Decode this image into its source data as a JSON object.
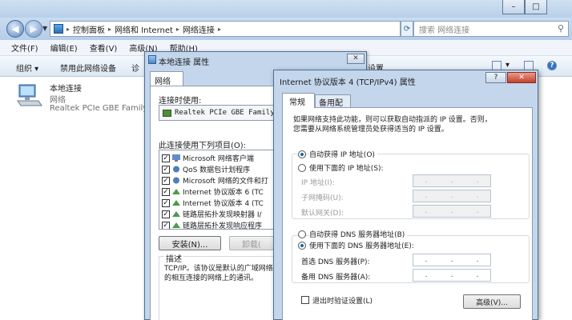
{
  "explorer": {
    "window_controls": [
      "–",
      "□"
    ],
    "address": {
      "crumbs": [
        "控制面板",
        "网络和 Internet",
        "网络连接"
      ],
      "dropdown_glyph": "▾"
    },
    "search_placeholder": "搜索 网络连接",
    "menu": [
      "文件(F)",
      "编辑(E)",
      "查看(V)",
      "高级(N)",
      "帮助(H)"
    ],
    "toolbar": {
      "organize": "组织 ▾",
      "disable": "禁用此网络设备",
      "diagnose_partial": "诊",
      "settings_partial": "设置",
      "view_dropdown": "▾"
    },
    "connection": {
      "name": "本地连接",
      "network": "网络",
      "adapter": "Realtek PCIe GBE Family"
    }
  },
  "dialog_props": {
    "title": "本地连接 属性",
    "close": "✕",
    "tab": "网络",
    "connect_using_label": "连接时使用:",
    "adapter": "Realtek PCIe GBE Family Co",
    "items_label": "此连接使用下列项目(O):",
    "items": [
      {
        "label": "Microsoft 网络客户端"
      },
      {
        "label": "QoS 数据包计划程序"
      },
      {
        "label": "Microsoft 网络的文件和打"
      },
      {
        "label": "Internet 协议版本 6 (TC"
      },
      {
        "label": "Internet 协议版本 4 (TC"
      },
      {
        "label": "链路层拓扑发现映射器 I/"
      },
      {
        "label": "链路层拓扑发现响应程序"
      }
    ],
    "install_button": "安装(N)...",
    "uninstall_button": "卸载(",
    "desc_label": "描述",
    "desc_lines": [
      "TCP/IP。该协议是默认的广域网络",
      "的相互连接的网络上的通讯。"
    ]
  },
  "dialog_ipv4": {
    "title": "Internet 协议版本 4 (TCP/IPv4) 属性",
    "help": "?",
    "close": "✕",
    "tabs": [
      "常规",
      "备用配置"
    ],
    "intro": [
      "如果网络支持此功能，则可以获取自动指派的 IP 设置。否则，",
      "您需要从网络系统管理员处获得适当的 IP 设置。"
    ],
    "auto_ip": "自动获得 IP 地址(O)",
    "manual_ip": "使用下面的 IP 地址(S):",
    "ip_label": "IP 地址(I):",
    "mask_label": "子网掩码(U):",
    "gateway_label": "默认网关(D):",
    "auto_dns": "自动获得 DNS 服务器地址(B)",
    "manual_dns": "使用下面的 DNS 服务器地址(E):",
    "preferred_dns": "首选 DNS 服务器(P):",
    "alternate_dns": "备用 DNS 服务器(A):",
    "ip_dots": ".",
    "validate": "退出时验证设置(L)",
    "advanced": "高级(V)..."
  }
}
